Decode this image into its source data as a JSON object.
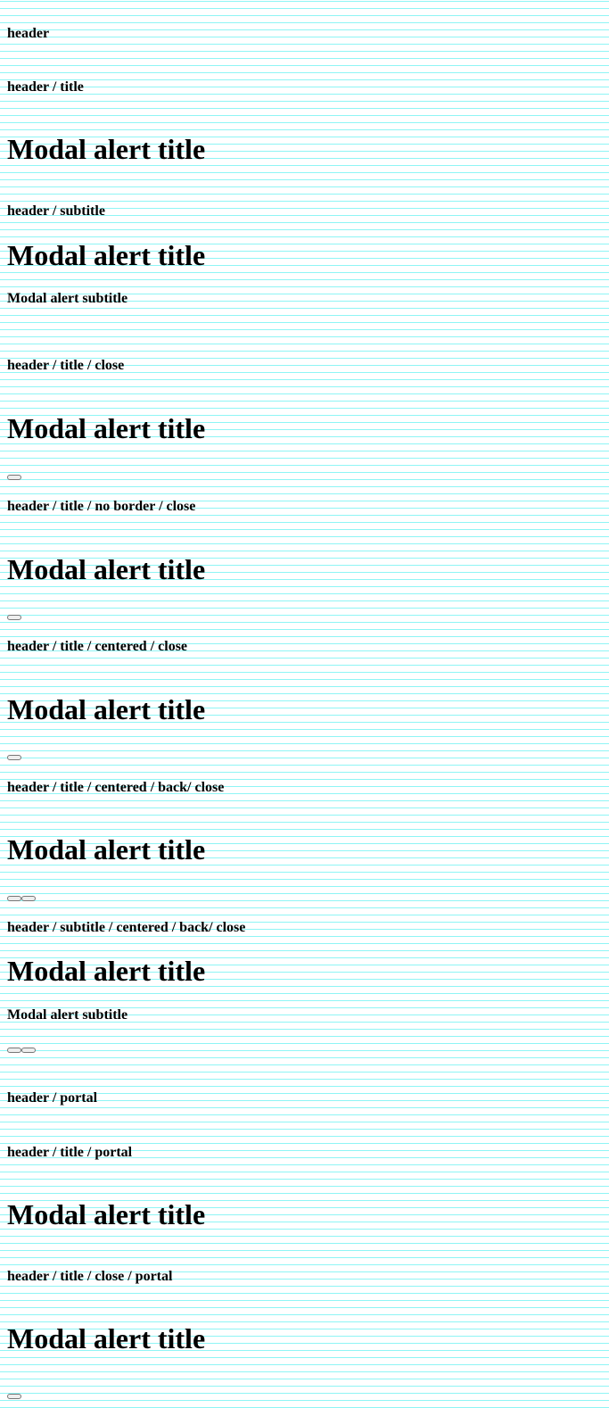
{
  "sections": [
    {
      "label": "header"
    },
    {
      "label": "header / title",
      "title": "Modal alert title"
    },
    {
      "label": "header / subtitle",
      "title": "Modal alert title",
      "subtitle": "Modal alert subtitle"
    },
    {
      "label": "header / title / close",
      "title": "Modal alert title"
    },
    {
      "label": "header / title / no border / close",
      "title": "Modal alert title"
    },
    {
      "label": "header / title / centered / close",
      "title": "Modal alert title"
    },
    {
      "label": "header / title / centered / back/ close",
      "title": "Modal alert title"
    },
    {
      "label": "header / subtitle / centered / back/ close",
      "title": "Modal alert title",
      "subtitle": "Modal alert subtitle"
    },
    {
      "label": "header / portal"
    },
    {
      "label": "header / title / portal",
      "title": "Modal alert title"
    },
    {
      "label": "header / title / close / portal",
      "title": "Modal alert title"
    }
  ]
}
